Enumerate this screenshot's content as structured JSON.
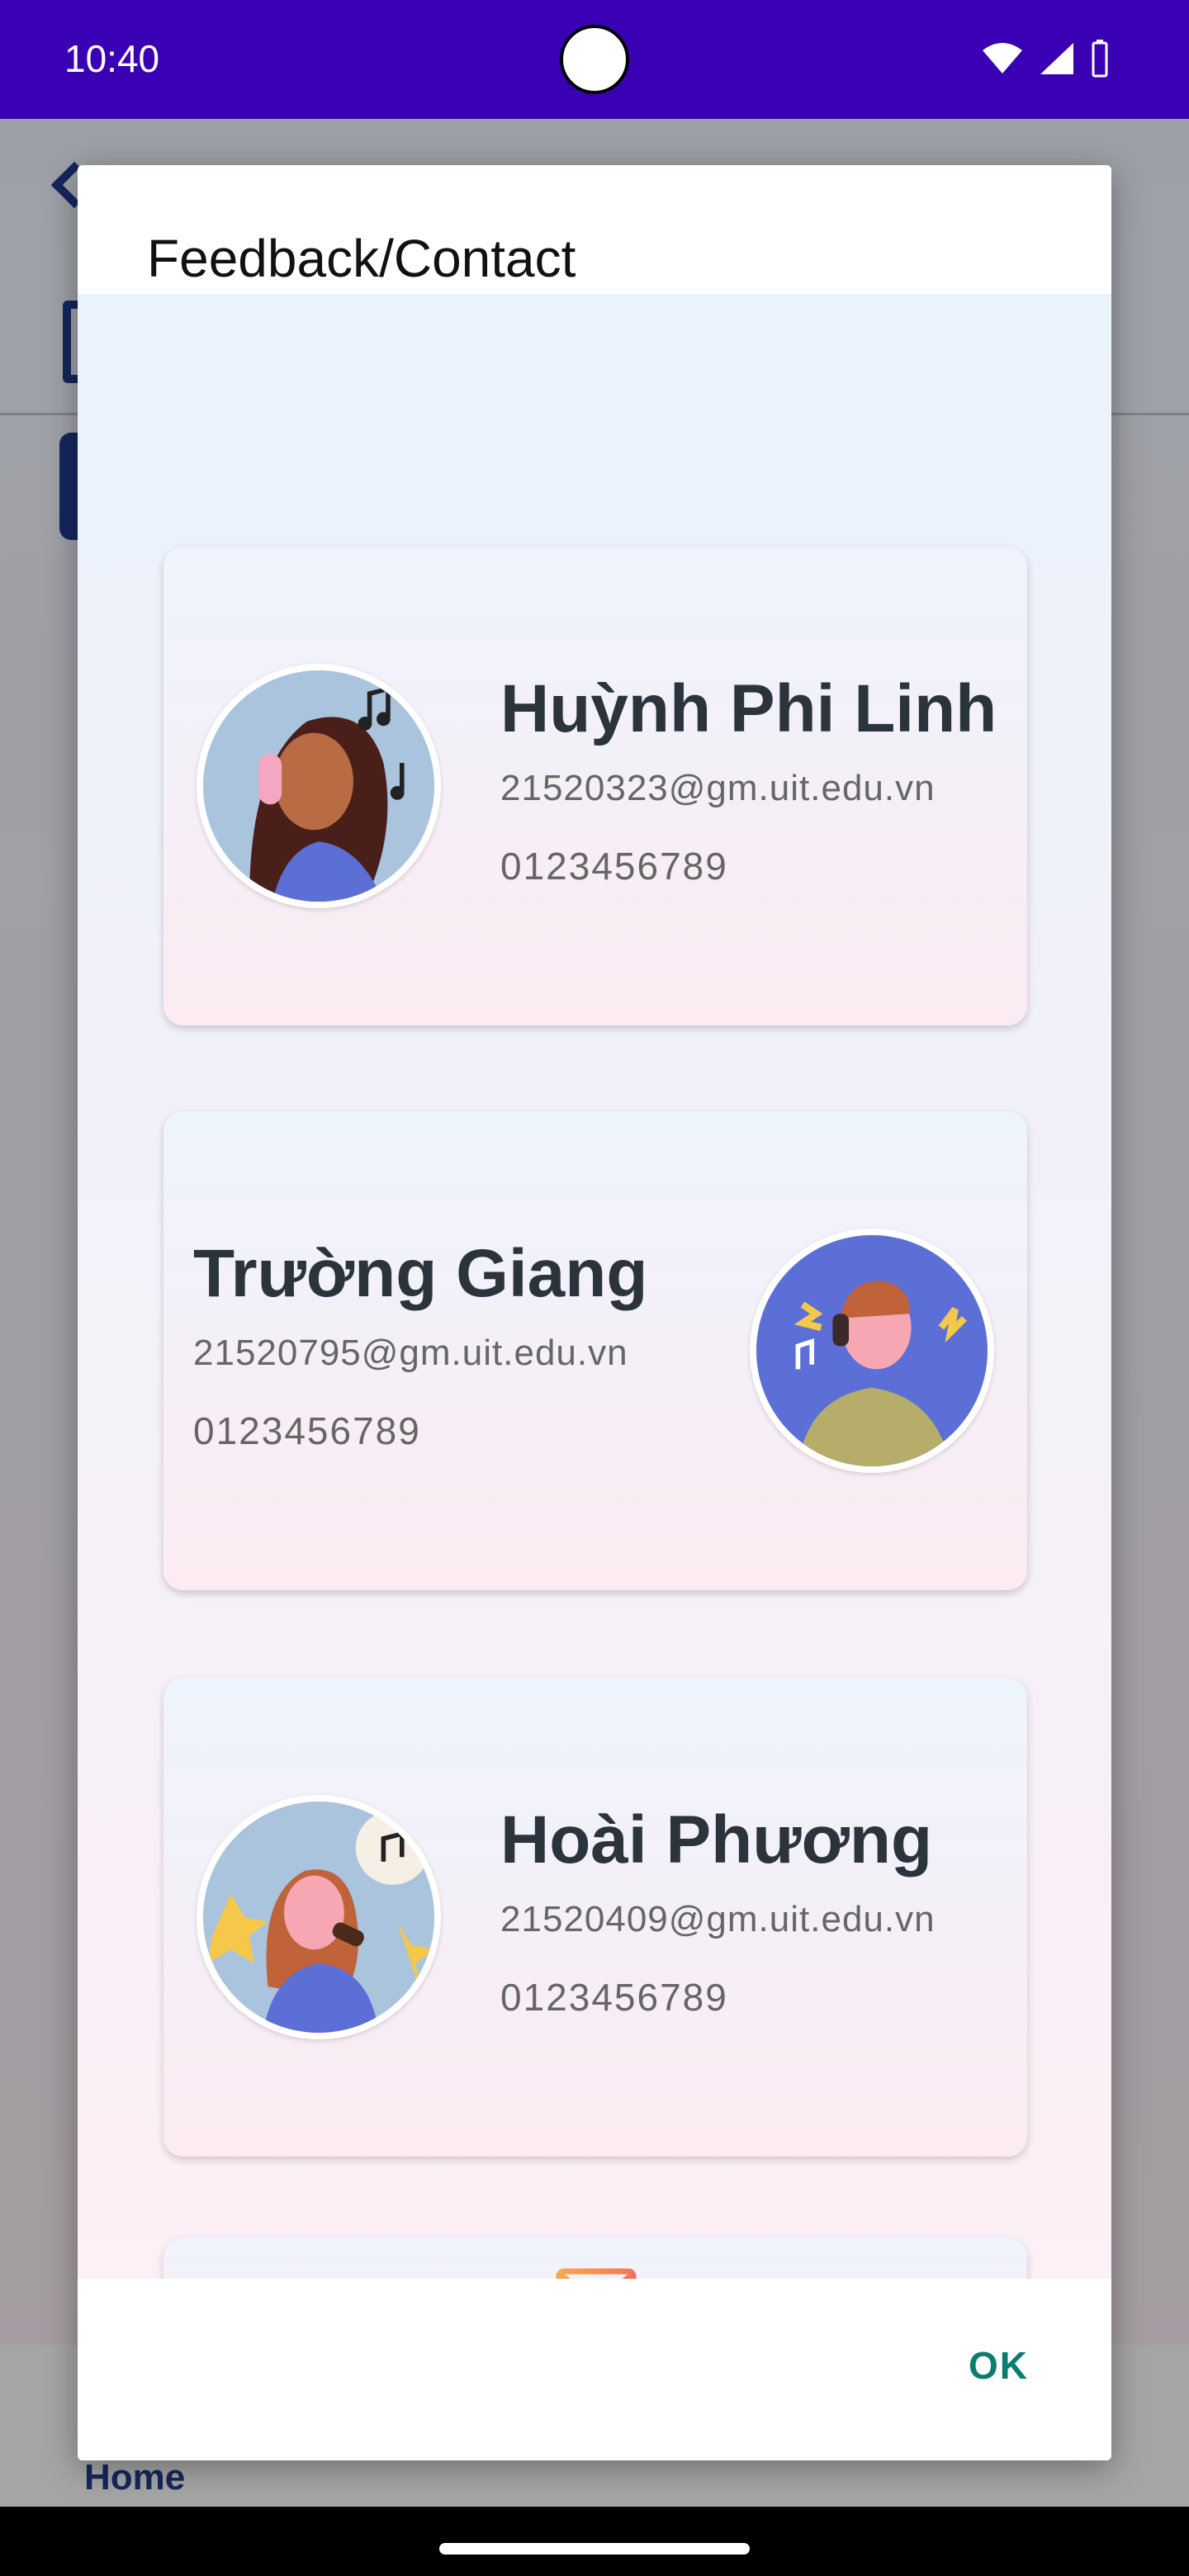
{
  "status_bar": {
    "time": "10:40",
    "icons": [
      "wifi-icon",
      "signal-icon",
      "battery-icon"
    ]
  },
  "background": {
    "nav_home_label": "Home"
  },
  "dialog": {
    "title": "Feedback/Contact",
    "ok_label": "OK",
    "contacts": [
      {
        "name": "Huỳnh Phi Linh",
        "email": "21520323@gm.uit.edu.vn",
        "phone": "0123456789",
        "avatar": "woman-headphones-avatar"
      },
      {
        "name": "Trường Giang",
        "email": "21520795@gm.uit.edu.vn",
        "phone": "0123456789",
        "avatar": "man-headphones-avatar"
      },
      {
        "name": "Hoài Phương",
        "email": "21520409@gm.uit.edu.vn",
        "phone": "0123456789",
        "avatar": "woman-singing-avatar"
      }
    ],
    "mail_button_icon": "mail-icon"
  },
  "colors": {
    "status_bar": "#3a00b3",
    "ok_text": "#0a7d70",
    "name_text": "#2b333d",
    "mail_icon": "#f0605a"
  }
}
